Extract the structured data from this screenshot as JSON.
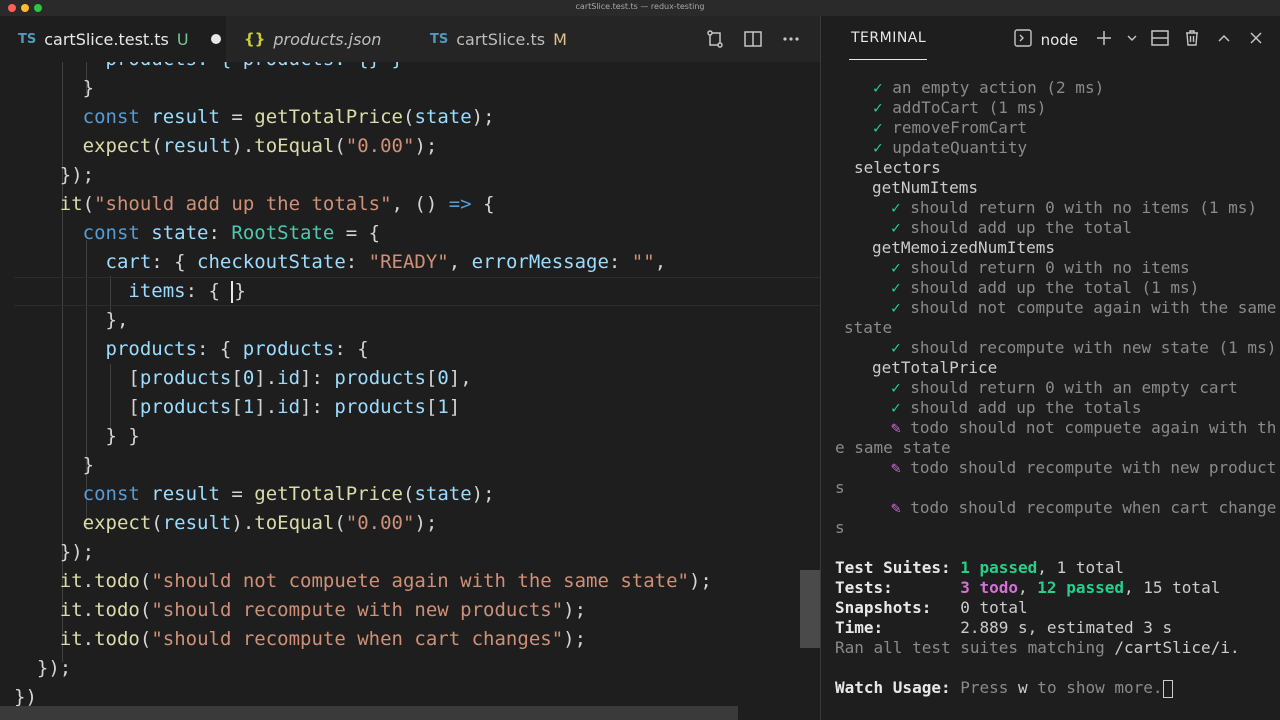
{
  "window": {
    "title": "cartSlice.test.ts — redux-testing"
  },
  "tabs": [
    {
      "badge": "TS",
      "label": "cartSlice.test.ts",
      "status": "U"
    },
    {
      "badge": "{}",
      "label": "products.json"
    },
    {
      "badge": "TS",
      "label": "cartSlice.ts",
      "status": "M"
    }
  ],
  "editor_icons": [
    "source-control-icon",
    "split-editor-icon",
    "more-icon"
  ],
  "code": {
    "l1": "products: { products: {} }",
    "l2": "}",
    "l3_a": "const",
    "l3_b": "result",
    "l3_c": "getTotalPrice",
    "l3_d": "state",
    "l4_a": "expect",
    "l4_b": "result",
    "l4_c": "toEqual",
    "l4_d": "\"0.00\"",
    "l5": "});",
    "l6_a": "it",
    "l6_b": "\"should add up the totals\"",
    "l6_c": "=>",
    "l7_a": "const",
    "l7_b": "state",
    "l7_c": "RootState",
    "l8_a": "cart",
    "l8_b": "checkoutState",
    "l8_c": "\"READY\"",
    "l8_d": "errorMessage",
    "l8_e": "\"\"",
    "l9_a": "items",
    "l10": "},",
    "l11_a": "products",
    "l11_b": "products",
    "l12_a": "products",
    "l12_b": "0",
    "l12_c": "id",
    "l12_d": "products",
    "l12_e": "0",
    "l13_a": "products",
    "l13_b": "1",
    "l13_c": "id",
    "l13_d": "products",
    "l13_e": "1",
    "l14": "} }",
    "l15": "}",
    "l16_a": "const",
    "l16_b": "result",
    "l16_c": "getTotalPrice",
    "l16_d": "state",
    "l17_a": "expect",
    "l17_b": "result",
    "l17_c": "toEqual",
    "l17_d": "\"0.00\"",
    "l18": "});",
    "l19_a": "it",
    "l19_b": "todo",
    "l19_c": "\"should not compuete again with the same state\"",
    "l20_a": "it",
    "l20_b": "todo",
    "l20_c": "\"should recompute with new products\"",
    "l21_a": "it",
    "l21_b": "todo",
    "l21_c": "\"should recompute when cart changes\"",
    "l22": "});",
    "l23": "})"
  },
  "terminal": {
    "tab_label": "TERMINAL",
    "shell": "node",
    "lines": {
      "t1": "an empty action (2 ms)",
      "t2": "addToCart (1 ms)",
      "t3": "removeFromCart",
      "t4": "updateQuantity",
      "t5": "selectors",
      "t6": "getNumItems",
      "t7": "should return 0 with no items (1 ms)",
      "t8": "should add up the total",
      "t9": "getMemoizedNumItems",
      "t10": "should return 0 with no items",
      "t11": "should add up the total (1 ms)",
      "t12": "should not compute again with the same",
      "t13": "state",
      "t14": "should recompute with new state (1 ms)",
      "t15": "getTotalPrice",
      "t16": "should return 0 with an empty cart",
      "t17": "should add up the totals",
      "t18": "todo should not compuete again with th",
      "t19": "e same state",
      "t20": "todo should recompute with new product",
      "t21": "s",
      "t22": "todo should recompute when cart change",
      "t23": "s"
    },
    "check_mark": "✓",
    "todo_mark": "✎",
    "summary": {
      "suites_label": "Test Suites:",
      "suites_passed": "1 passed",
      "suites_total": ", 1 total",
      "tests_label": "Tests:",
      "tests_todo": "3 todo",
      "tests_passed": "12 passed",
      "tests_total": ", 15 total",
      "snap_label": "Snapshots:",
      "snap_value": "0 total",
      "time_label": "Time:",
      "time_value": "2.889 s, estimated 3 s",
      "ran_prefix": "Ran all test suites matching ",
      "ran_pattern": "/cartSlice/i.",
      "watch_label": "Watch Usage:",
      "watch_prefix": "Press ",
      "watch_key": "w",
      "watch_suffix": " to show more."
    }
  }
}
